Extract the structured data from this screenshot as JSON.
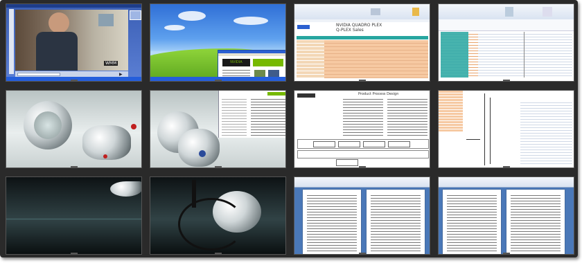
{
  "wall": {
    "rows": 3,
    "columns": 4
  },
  "panels": [
    {
      "content": "Video playback in media player",
      "overlay_logo": "WMM",
      "overlay_text": ""
    },
    {
      "content": "Windows XP desktop with browser window",
      "browser_logo": "NVIDIA"
    },
    {
      "content": "Spreadsheet with orange data table",
      "title_line1": "NVIDIA QUADRO PLEX",
      "title_line2": "Q-PLEX Sales"
    },
    {
      "content": "Spreadsheet with narrow columns"
    },
    {
      "content": "3D render of metallic object"
    },
    {
      "content": "3D render with document window"
    },
    {
      "content": "Document with flowchart",
      "doc_title": "Product Process Design"
    },
    {
      "content": "Spreadsheet page view"
    },
    {
      "content": "Dark 3D render"
    },
    {
      "content": "Dark 3D render with cable"
    },
    {
      "content": "Word document two pages"
    },
    {
      "content": "Word document two pages"
    }
  ],
  "colors": {
    "bezel": "#2a2a2a",
    "xp_blue": "#3b5fb5",
    "excel_orange": "#f6c9a2",
    "nvidia_green": "#76b900"
  }
}
